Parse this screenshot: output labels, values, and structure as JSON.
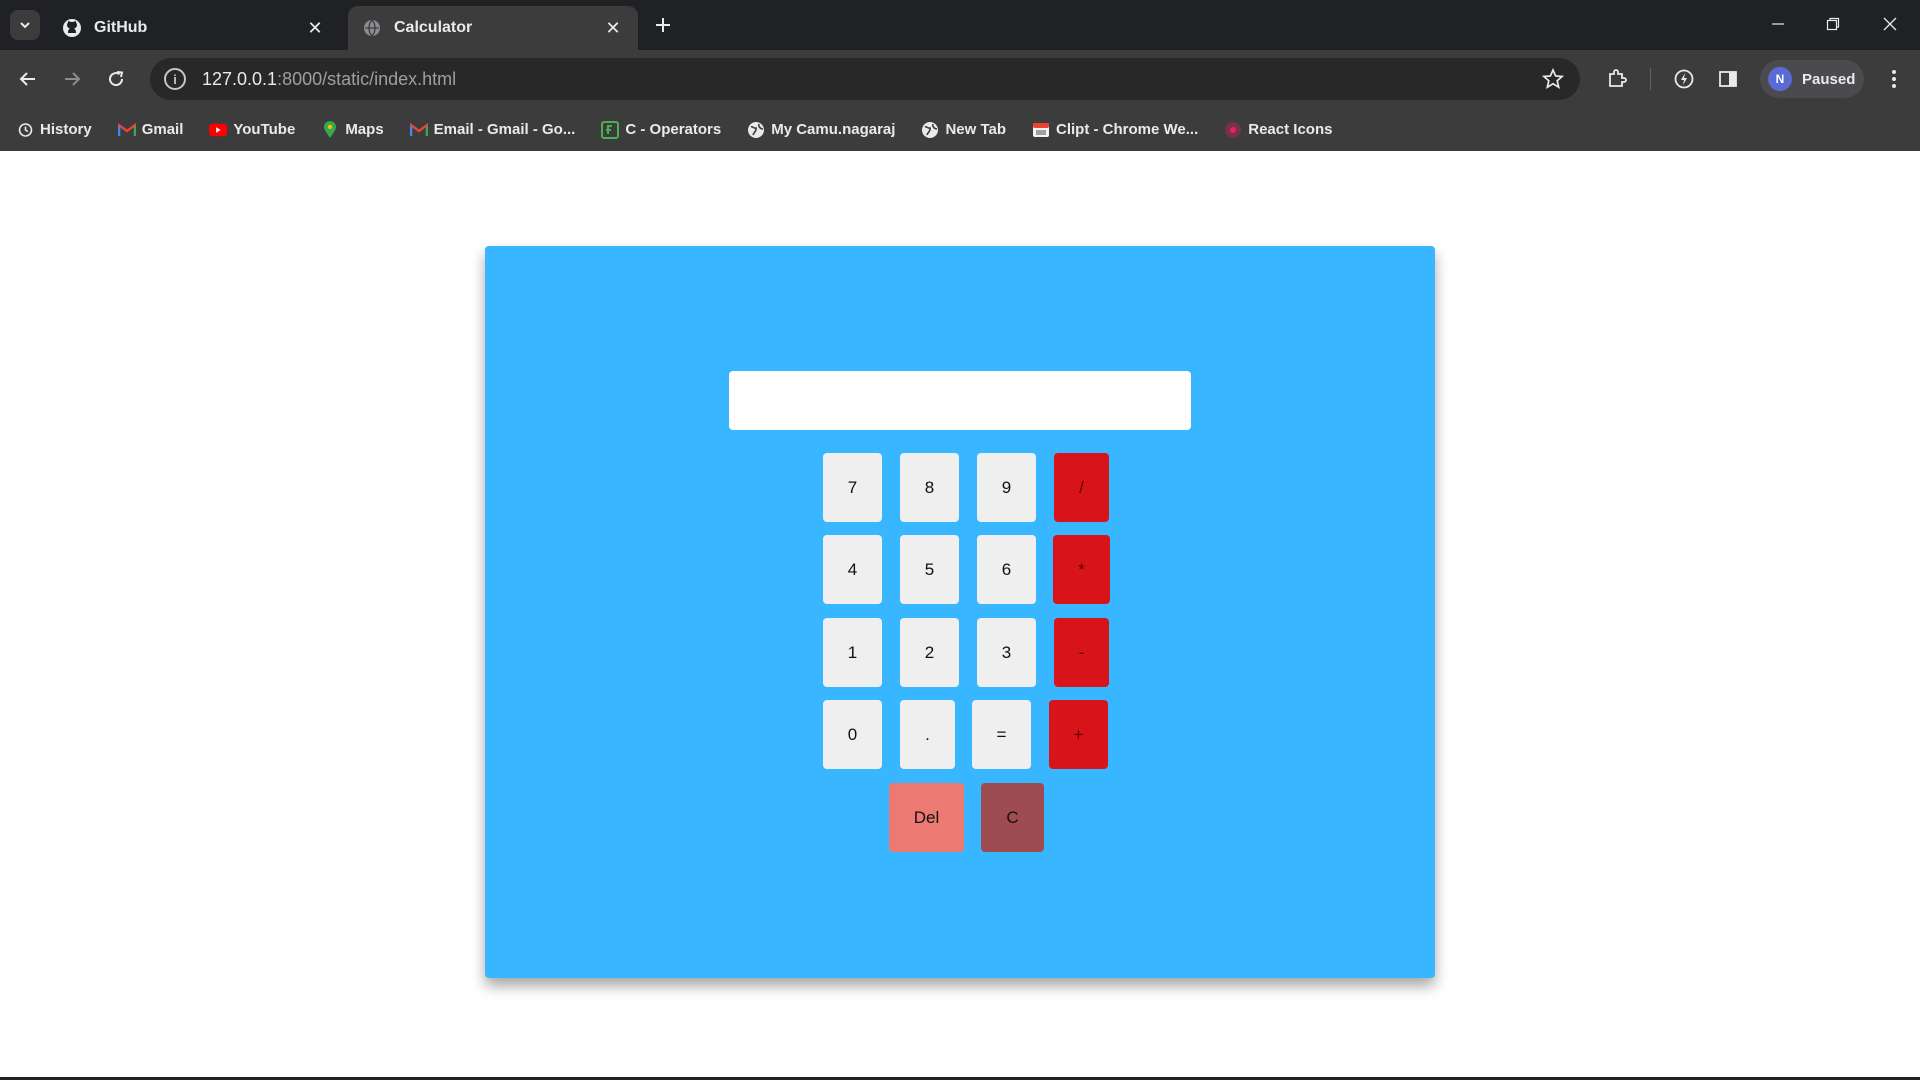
{
  "browser": {
    "tabs": [
      {
        "title": "GitHub",
        "icon": "github-icon"
      },
      {
        "title": "Calculator",
        "icon": "globe-icon"
      }
    ],
    "url": {
      "host": "127.0.0.1",
      "path": ":8000/static/index.html"
    },
    "profile": {
      "initial": "N",
      "label": "Paused"
    },
    "bookmarks": [
      {
        "label": "History",
        "icon": "history-icon"
      },
      {
        "label": "Gmail",
        "icon": "gmail-icon"
      },
      {
        "label": "YouTube",
        "icon": "youtube-icon"
      },
      {
        "label": "Maps",
        "icon": "maps-icon"
      },
      {
        "label": "Email - Gmail - Go...",
        "icon": "gmail-icon"
      },
      {
        "label": "C - Operators",
        "icon": "site-icon"
      },
      {
        "label": "My Camu.nagaraj",
        "icon": "globe-icon"
      },
      {
        "label": "New Tab",
        "icon": "globe-icon"
      },
      {
        "label": "Clipt - Chrome We...",
        "icon": "clipt-icon"
      },
      {
        "label": "React Icons",
        "icon": "react-icon"
      }
    ]
  },
  "calculator": {
    "display_value": "",
    "keys": {
      "seven": "7",
      "eight": "8",
      "nine": "9",
      "divide": "/",
      "four": "4",
      "five": "5",
      "six": "6",
      "multiply": "*",
      "one": "1",
      "two": "2",
      "three": "3",
      "subtract": "-",
      "zero": "0",
      "dot": ".",
      "equals": "=",
      "add": "+",
      "del": "Del",
      "clear": "C"
    },
    "colors": {
      "background": "#38b6ff",
      "number_key": "#efefef",
      "operator_key": "#d8141a",
      "del_key": "#ec7a72",
      "clear_key": "#9f4b52"
    }
  }
}
